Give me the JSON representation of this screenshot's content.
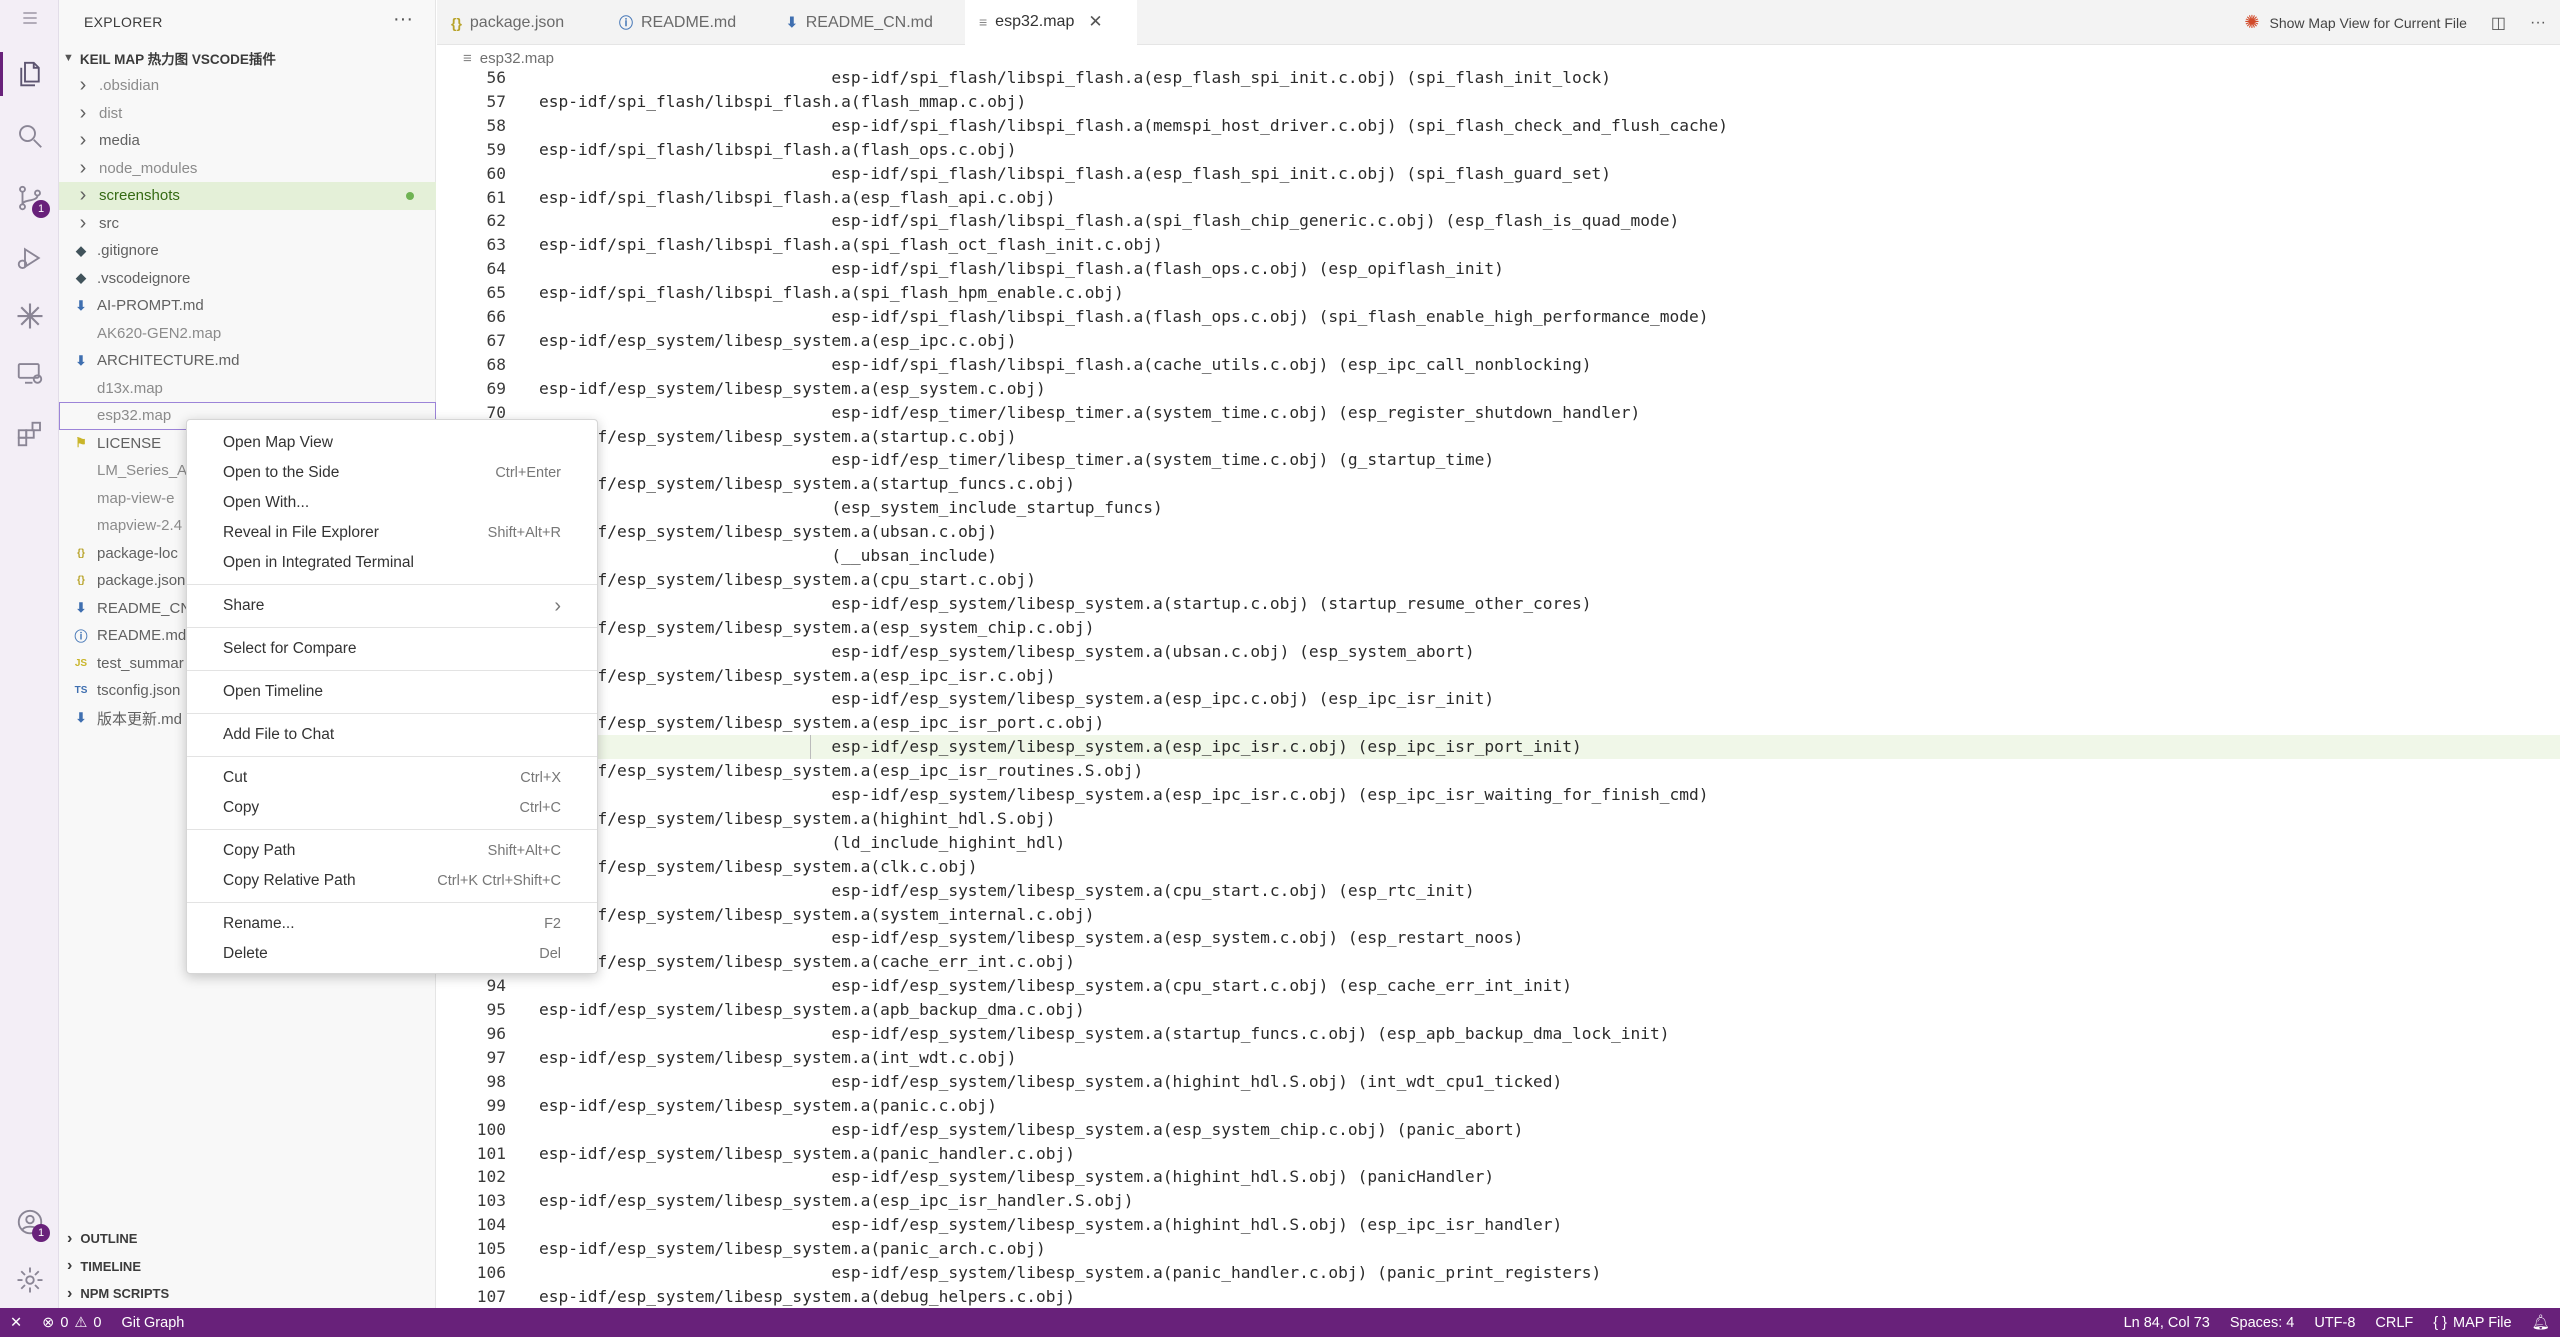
{
  "explorer": {
    "title": "EXPLORER",
    "project": "KEIL MAP 热力图 VSCODE插件",
    "items": [
      {
        "label": ".obsidian",
        "type": "folder"
      },
      {
        "label": "dist",
        "type": "folder"
      },
      {
        "label": "media",
        "type": "folder"
      },
      {
        "label": "node_modules",
        "type": "folder"
      },
      {
        "label": "screenshots",
        "type": "folder"
      },
      {
        "label": "src",
        "type": "folder"
      },
      {
        "label": ".gitignore",
        "type": "file"
      },
      {
        "label": ".vscodeignore",
        "type": "file"
      },
      {
        "label": "AI-PROMPT.md",
        "type": "file"
      },
      {
        "label": "AK620-GEN2.map",
        "type": "file"
      },
      {
        "label": "ARCHITECTURE.md",
        "type": "file"
      },
      {
        "label": "d13x.map",
        "type": "file"
      },
      {
        "label": "esp32.map",
        "type": "file"
      },
      {
        "label": "LICENSE",
        "type": "file"
      },
      {
        "label": "LM_Series_A",
        "type": "file"
      },
      {
        "label": "map-view-e",
        "type": "file"
      },
      {
        "label": "mapview-2.4",
        "type": "file"
      },
      {
        "label": "package-loc",
        "type": "file"
      },
      {
        "label": "package.json",
        "type": "file"
      },
      {
        "label": "README_CN",
        "type": "file"
      },
      {
        "label": "README.md",
        "type": "file"
      },
      {
        "label": "test_summar",
        "type": "file"
      },
      {
        "label": "tsconfig.json",
        "type": "file"
      },
      {
        "label": "版本更新.md",
        "type": "file"
      }
    ],
    "panels": [
      "OUTLINE",
      "TIMELINE",
      "NPM SCRIPTS"
    ]
  },
  "tabs": [
    {
      "label": "package.json",
      "icon": "{}"
    },
    {
      "label": "README.md",
      "icon": "ⓘ"
    },
    {
      "label": "README_CN.md",
      "icon": "⬇"
    },
    {
      "label": "esp32.map",
      "icon": "≡"
    }
  ],
  "toolbar": {
    "map_view_label": "Show Map View for Current File"
  },
  "breadcrumb": "esp32.map",
  "code_lines": [
    {
      "n": "56",
      "t": "                              esp-idf/spi_flash/libspi_flash.a(esp_flash_spi_init.c.obj) (spi_flash_init_lock)"
    },
    {
      "n": "57",
      "t": "esp-idf/spi_flash/libspi_flash.a(flash_mmap.c.obj)"
    },
    {
      "n": "58",
      "t": "                              esp-idf/spi_flash/libspi_flash.a(memspi_host_driver.c.obj) (spi_flash_check_and_flush_cache)"
    },
    {
      "n": "59",
      "t": "esp-idf/spi_flash/libspi_flash.a(flash_ops.c.obj)"
    },
    {
      "n": "60",
      "t": "                              esp-idf/spi_flash/libspi_flash.a(esp_flash_spi_init.c.obj) (spi_flash_guard_set)"
    },
    {
      "n": "61",
      "t": "esp-idf/spi_flash/libspi_flash.a(esp_flash_api.c.obj)"
    },
    {
      "n": "62",
      "t": "                              esp-idf/spi_flash/libspi_flash.a(spi_flash_chip_generic.c.obj) (esp_flash_is_quad_mode)"
    },
    {
      "n": "63",
      "t": "esp-idf/spi_flash/libspi_flash.a(spi_flash_oct_flash_init.c.obj)"
    },
    {
      "n": "64",
      "t": "                              esp-idf/spi_flash/libspi_flash.a(flash_ops.c.obj) (esp_opiflash_init)"
    },
    {
      "n": "65",
      "t": "esp-idf/spi_flash/libspi_flash.a(spi_flash_hpm_enable.c.obj)"
    },
    {
      "n": "66",
      "t": "                              esp-idf/spi_flash/libspi_flash.a(flash_ops.c.obj) (spi_flash_enable_high_performance_mode)"
    },
    {
      "n": "67",
      "t": "esp-idf/esp_system/libesp_system.a(esp_ipc.c.obj)"
    },
    {
      "n": "68",
      "t": "                              esp-idf/spi_flash/libspi_flash.a(cache_utils.c.obj) (esp_ipc_call_nonblocking)"
    },
    {
      "n": "69",
      "t": "esp-idf/esp_system/libesp_system.a(esp_system.c.obj)"
    },
    {
      "n": "70",
      "t": "                              esp-idf/esp_timer/libesp_timer.a(system_time.c.obj) (esp_register_shutdown_handler)"
    },
    {
      "n": "",
      "t": "esp-idf/esp_system/libesp_system.a(startup.c.obj)"
    },
    {
      "n": "",
      "t": "                              esp-idf/esp_timer/libesp_timer.a(system_time.c.obj) (g_startup_time)"
    },
    {
      "n": "",
      "t": "esp-idf/esp_system/libesp_system.a(startup_funcs.c.obj)"
    },
    {
      "n": "",
      "t": "                              (esp_system_include_startup_funcs)"
    },
    {
      "n": "",
      "t": "esp-idf/esp_system/libesp_system.a(ubsan.c.obj)"
    },
    {
      "n": "",
      "t": "                              (__ubsan_include)"
    },
    {
      "n": "",
      "t": "esp-idf/esp_system/libesp_system.a(cpu_start.c.obj)"
    },
    {
      "n": "",
      "t": "                              esp-idf/esp_system/libesp_system.a(startup.c.obj) (startup_resume_other_cores)"
    },
    {
      "n": "",
      "t": "esp-idf/esp_system/libesp_system.a(esp_system_chip.c.obj)"
    },
    {
      "n": "",
      "t": "                              esp-idf/esp_system/libesp_system.a(ubsan.c.obj) (esp_system_abort)"
    },
    {
      "n": "",
      "t": "esp-idf/esp_system/libesp_system.a(esp_ipc_isr.c.obj)"
    },
    {
      "n": "",
      "t": "                              esp-idf/esp_system/libesp_system.a(esp_ipc.c.obj) (esp_ipc_isr_init)"
    },
    {
      "n": "",
      "t": "esp-idf/esp_system/libesp_system.a(esp_ipc_isr_port.c.obj)"
    },
    {
      "n": "",
      "t": "                              esp-idf/esp_system/libesp_system.a(esp_ipc_isr.c.obj) (esp_ipc_isr_port_init)"
    },
    {
      "n": "",
      "t": "esp-idf/esp_system/libesp_system.a(esp_ipc_isr_routines.S.obj)"
    },
    {
      "n": "",
      "t": "                              esp-idf/esp_system/libesp_system.a(esp_ipc_isr.c.obj) (esp_ipc_isr_waiting_for_finish_cmd)"
    },
    {
      "n": "",
      "t": "esp-idf/esp_system/libesp_system.a(highint_hdl.S.obj)"
    },
    {
      "n": "",
      "t": "                              (ld_include_highint_hdl)"
    },
    {
      "n": "",
      "t": "esp-idf/esp_system/libesp_system.a(clk.c.obj)"
    },
    {
      "n": "",
      "t": "                              esp-idf/esp_system/libesp_system.a(cpu_start.c.obj) (esp_rtc_init)"
    },
    {
      "n": "",
      "t": "esp-idf/esp_system/libesp_system.a(system_internal.c.obj)"
    },
    {
      "n": "",
      "t": "                              esp-idf/esp_system/libesp_system.a(esp_system.c.obj) (esp_restart_noos)"
    },
    {
      "n": "",
      "t": "esp-idf/esp_system/libesp_system.a(cache_err_int.c.obj)"
    },
    {
      "n": "94",
      "t": "                              esp-idf/esp_system/libesp_system.a(cpu_start.c.obj) (esp_cache_err_int_init)"
    },
    {
      "n": "95",
      "t": "esp-idf/esp_system/libesp_system.a(apb_backup_dma.c.obj)"
    },
    {
      "n": "96",
      "t": "                              esp-idf/esp_system/libesp_system.a(startup_funcs.c.obj) (esp_apb_backup_dma_lock_init)"
    },
    {
      "n": "97",
      "t": "esp-idf/esp_system/libesp_system.a(int_wdt.c.obj)"
    },
    {
      "n": "98",
      "t": "                              esp-idf/esp_system/libesp_system.a(highint_hdl.S.obj) (int_wdt_cpu1_ticked)"
    },
    {
      "n": "99",
      "t": "esp-idf/esp_system/libesp_system.a(panic.c.obj)"
    },
    {
      "n": "100",
      "t": "                              esp-idf/esp_system/libesp_system.a(esp_system_chip.c.obj) (panic_abort)"
    },
    {
      "n": "101",
      "t": "esp-idf/esp_system/libesp_system.a(panic_handler.c.obj)"
    },
    {
      "n": "102",
      "t": "                              esp-idf/esp_system/libesp_system.a(highint_hdl.S.obj) (panicHandler)"
    },
    {
      "n": "103",
      "t": "esp-idf/esp_system/libesp_system.a(esp_ipc_isr_handler.S.obj)"
    },
    {
      "n": "104",
      "t": "                              esp-idf/esp_system/libesp_system.a(highint_hdl.S.obj) (esp_ipc_isr_handler)"
    },
    {
      "n": "105",
      "t": "esp-idf/esp_system/libesp_system.a(panic_arch.c.obj)"
    },
    {
      "n": "106",
      "t": "                              esp-idf/esp_system/libesp_system.a(panic_handler.c.obj) (panic_print_registers)"
    },
    {
      "n": "107",
      "t": "esp-idf/esp_system/libesp_system.a(debug_helpers.c.obj)"
    }
  ],
  "context_menu": [
    {
      "label": "Open Map View",
      "kb": ""
    },
    {
      "label": "Open to the Side",
      "kb": "Ctrl+Enter"
    },
    {
      "label": "Open With...",
      "kb": ""
    },
    {
      "label": "Reveal in File Explorer",
      "kb": "Shift+Alt+R"
    },
    {
      "label": "Open in Integrated Terminal",
      "kb": ""
    },
    {
      "sep": true
    },
    {
      "label": "Share",
      "kb": "›"
    },
    {
      "sep": true
    },
    {
      "label": "Select for Compare",
      "kb": ""
    },
    {
      "sep": true
    },
    {
      "label": "Open Timeline",
      "kb": ""
    },
    {
      "sep": true
    },
    {
      "label": "Add File to Chat",
      "kb": ""
    },
    {
      "sep": true
    },
    {
      "label": "Cut",
      "kb": "Ctrl+X"
    },
    {
      "label": "Copy",
      "kb": "Ctrl+C"
    },
    {
      "sep": true
    },
    {
      "label": "Copy Path",
      "kb": "Shift+Alt+C"
    },
    {
      "label": "Copy Relative Path",
      "kb": "Ctrl+K Ctrl+Shift+C"
    },
    {
      "sep": true
    },
    {
      "label": "Rename...",
      "kb": "F2"
    },
    {
      "label": "Delete",
      "kb": "Del"
    }
  ],
  "status": {
    "errors": "0",
    "warnings": "0",
    "git_graph": "Git Graph",
    "position": "Ln 84, Col 73",
    "spaces": "Spaces: 4",
    "encoding": "UTF-8",
    "eol": "CRLF",
    "language": "MAP File"
  },
  "badges": {
    "scm": "1",
    "accounts": "1"
  },
  "colors": {
    "accent": "#68217a",
    "selection": "#e4f0d8"
  }
}
